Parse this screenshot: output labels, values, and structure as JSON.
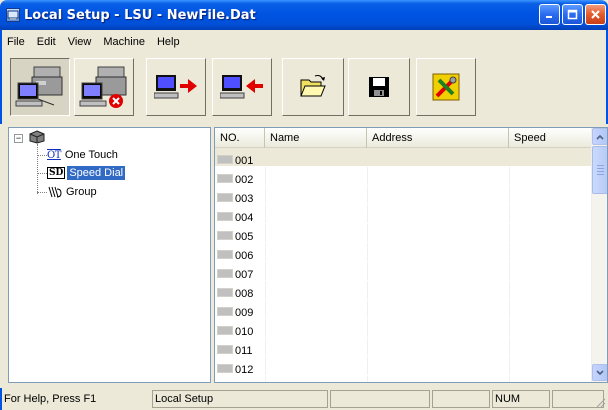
{
  "window": {
    "title": "Local Setup - LSU - NewFile.Dat",
    "controls": [
      "minimize",
      "maximize",
      "close"
    ]
  },
  "menu": {
    "items": [
      {
        "label": "File"
      },
      {
        "label": "Edit"
      },
      {
        "label": "View"
      },
      {
        "label": "Machine"
      },
      {
        "label": "Help"
      }
    ]
  },
  "toolbar": {
    "buttons": [
      {
        "icon": "machine-icon",
        "pressed": true
      },
      {
        "icon": "machine-disconnect-icon",
        "pressed": false
      },
      {
        "icon": "send-to-machine-icon",
        "pressed": false
      },
      {
        "icon": "receive-from-machine-icon",
        "pressed": false
      },
      {
        "icon": "open-folder-icon",
        "pressed": false
      },
      {
        "icon": "save-disk-icon",
        "pressed": false
      },
      {
        "icon": "tools-icon",
        "pressed": false
      }
    ]
  },
  "tree": {
    "root_icon": "machine-root-icon",
    "expander": "−",
    "items": [
      {
        "badge": "OT",
        "label": "One Touch",
        "selected": false
      },
      {
        "badge": "SD",
        "label": "Speed Dial",
        "selected": true
      },
      {
        "badge": "",
        "label": "Group",
        "selected": false
      }
    ]
  },
  "list": {
    "columns": [
      {
        "label": "NO."
      },
      {
        "label": "Name"
      },
      {
        "label": "Address"
      },
      {
        "label": "Speed"
      }
    ],
    "rows": [
      {
        "no": "001",
        "selected": true
      },
      {
        "no": "002"
      },
      {
        "no": "003"
      },
      {
        "no": "004"
      },
      {
        "no": "005"
      },
      {
        "no": "006"
      },
      {
        "no": "007"
      },
      {
        "no": "008"
      },
      {
        "no": "009"
      },
      {
        "no": "010"
      },
      {
        "no": "011"
      },
      {
        "no": "012"
      },
      {
        "no": ""
      }
    ]
  },
  "status": {
    "help": "For Help, Press F1",
    "mode": "Local Setup",
    "pane3": "",
    "pane4": "",
    "num": "NUM",
    "pane6": ""
  },
  "colors": {
    "titlebar": "#0054e3",
    "selection": "#316ac5",
    "face": "#ece9d8"
  }
}
